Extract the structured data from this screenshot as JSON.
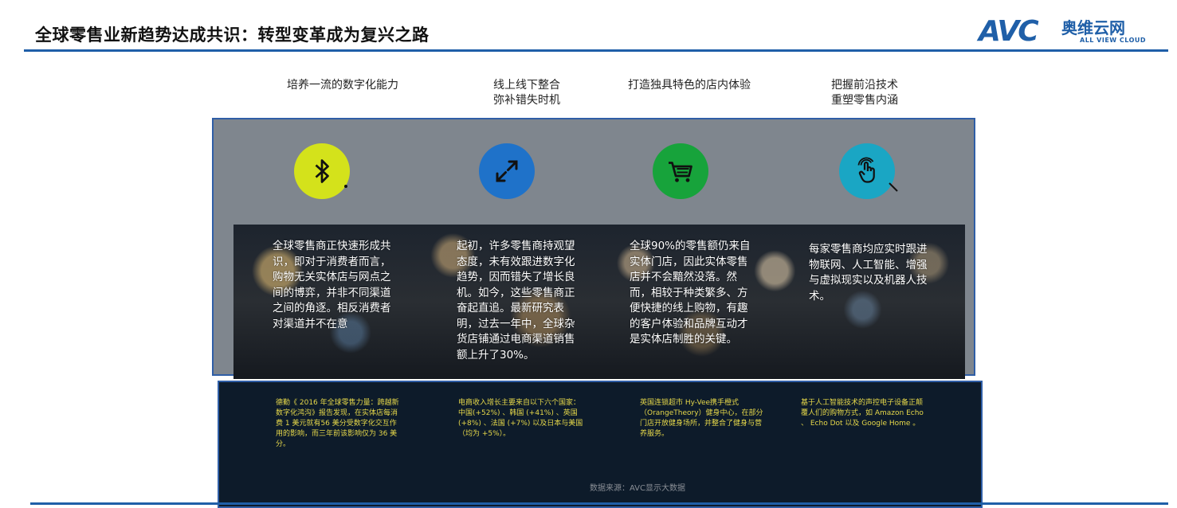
{
  "title": "全球零售业新趋势达成共识：转型变革成为复兴之路",
  "logo": {
    "mark": "AVC",
    "cn_name": "奥维云网",
    "en_name": "ALL VIEW CLOUD"
  },
  "columns": [
    {
      "heading": "培养一流的数字化能力",
      "icon": "bluetooth-icon",
      "icon_color": "#d4e21b",
      "body": "全球零售商正快速形成共识，即对于消费者而言，购物无关实体店与网点之间的博弈，并非不同渠道之间的角逐。相反消费者对渠道并不在意",
      "note": "德勤《 2016 年全球零售力量：跨越新数字化鸿沟》报告发现，在实体店每消费 1 美元就有56 美分受数字化交互作用的影响，而三年前该影响仅为 36 美分。"
    },
    {
      "heading": "线上线下整合\n弥补错失时机",
      "icon": "expand-arrows-icon",
      "icon_color": "#1f72c9",
      "body": "起初，许多零售商持观望态度，未有效跟进数字化趋势，因而错失了增长良机。如今，这些零售商正奋起直追。最新研究表明，过去一年中，全球杂货店铺通过电商渠道销售额上升了30%。",
      "note": "电商收入增长主要来自以下六个国家：中国(+52%) 、韩国 (+41%) 、英国 (+8%) 、法国 (+7%) 以及日本与美国（均为 +5%）。"
    },
    {
      "heading": "打造独具特色的店内体验",
      "icon": "shopping-cart-icon",
      "icon_color": "#17a33b",
      "body": "全球90%的零售额仍来自实体门店，因此实体零售店并不会黯然没落。然而，相较于种类繁多、方便快捷的线上购物，有趣的客户体验和品牌互动才是实体店制胜的关键。",
      "note": "英国连锁超市 Hy-Vee携手橙式（OrangeTheory）健身中心，在部分门店开放健身场所，并整合了健身与营养服务。"
    },
    {
      "heading": "把握前沿技术\n重塑零售内涵",
      "icon": "touch-hand-icon",
      "icon_color": "#1aa6c4",
      "body": "每家零售商均应实时跟进物联网、人工智能、增强与虚拟现实以及机器人技术。",
      "note": "基于人工智能技术的声控电子设备正颠覆人们的购物方式，如 Amazon Echo 、 Echo Dot 以及 Google Home 。"
    }
  ],
  "source": "数据来源：AVC显示大数据"
}
